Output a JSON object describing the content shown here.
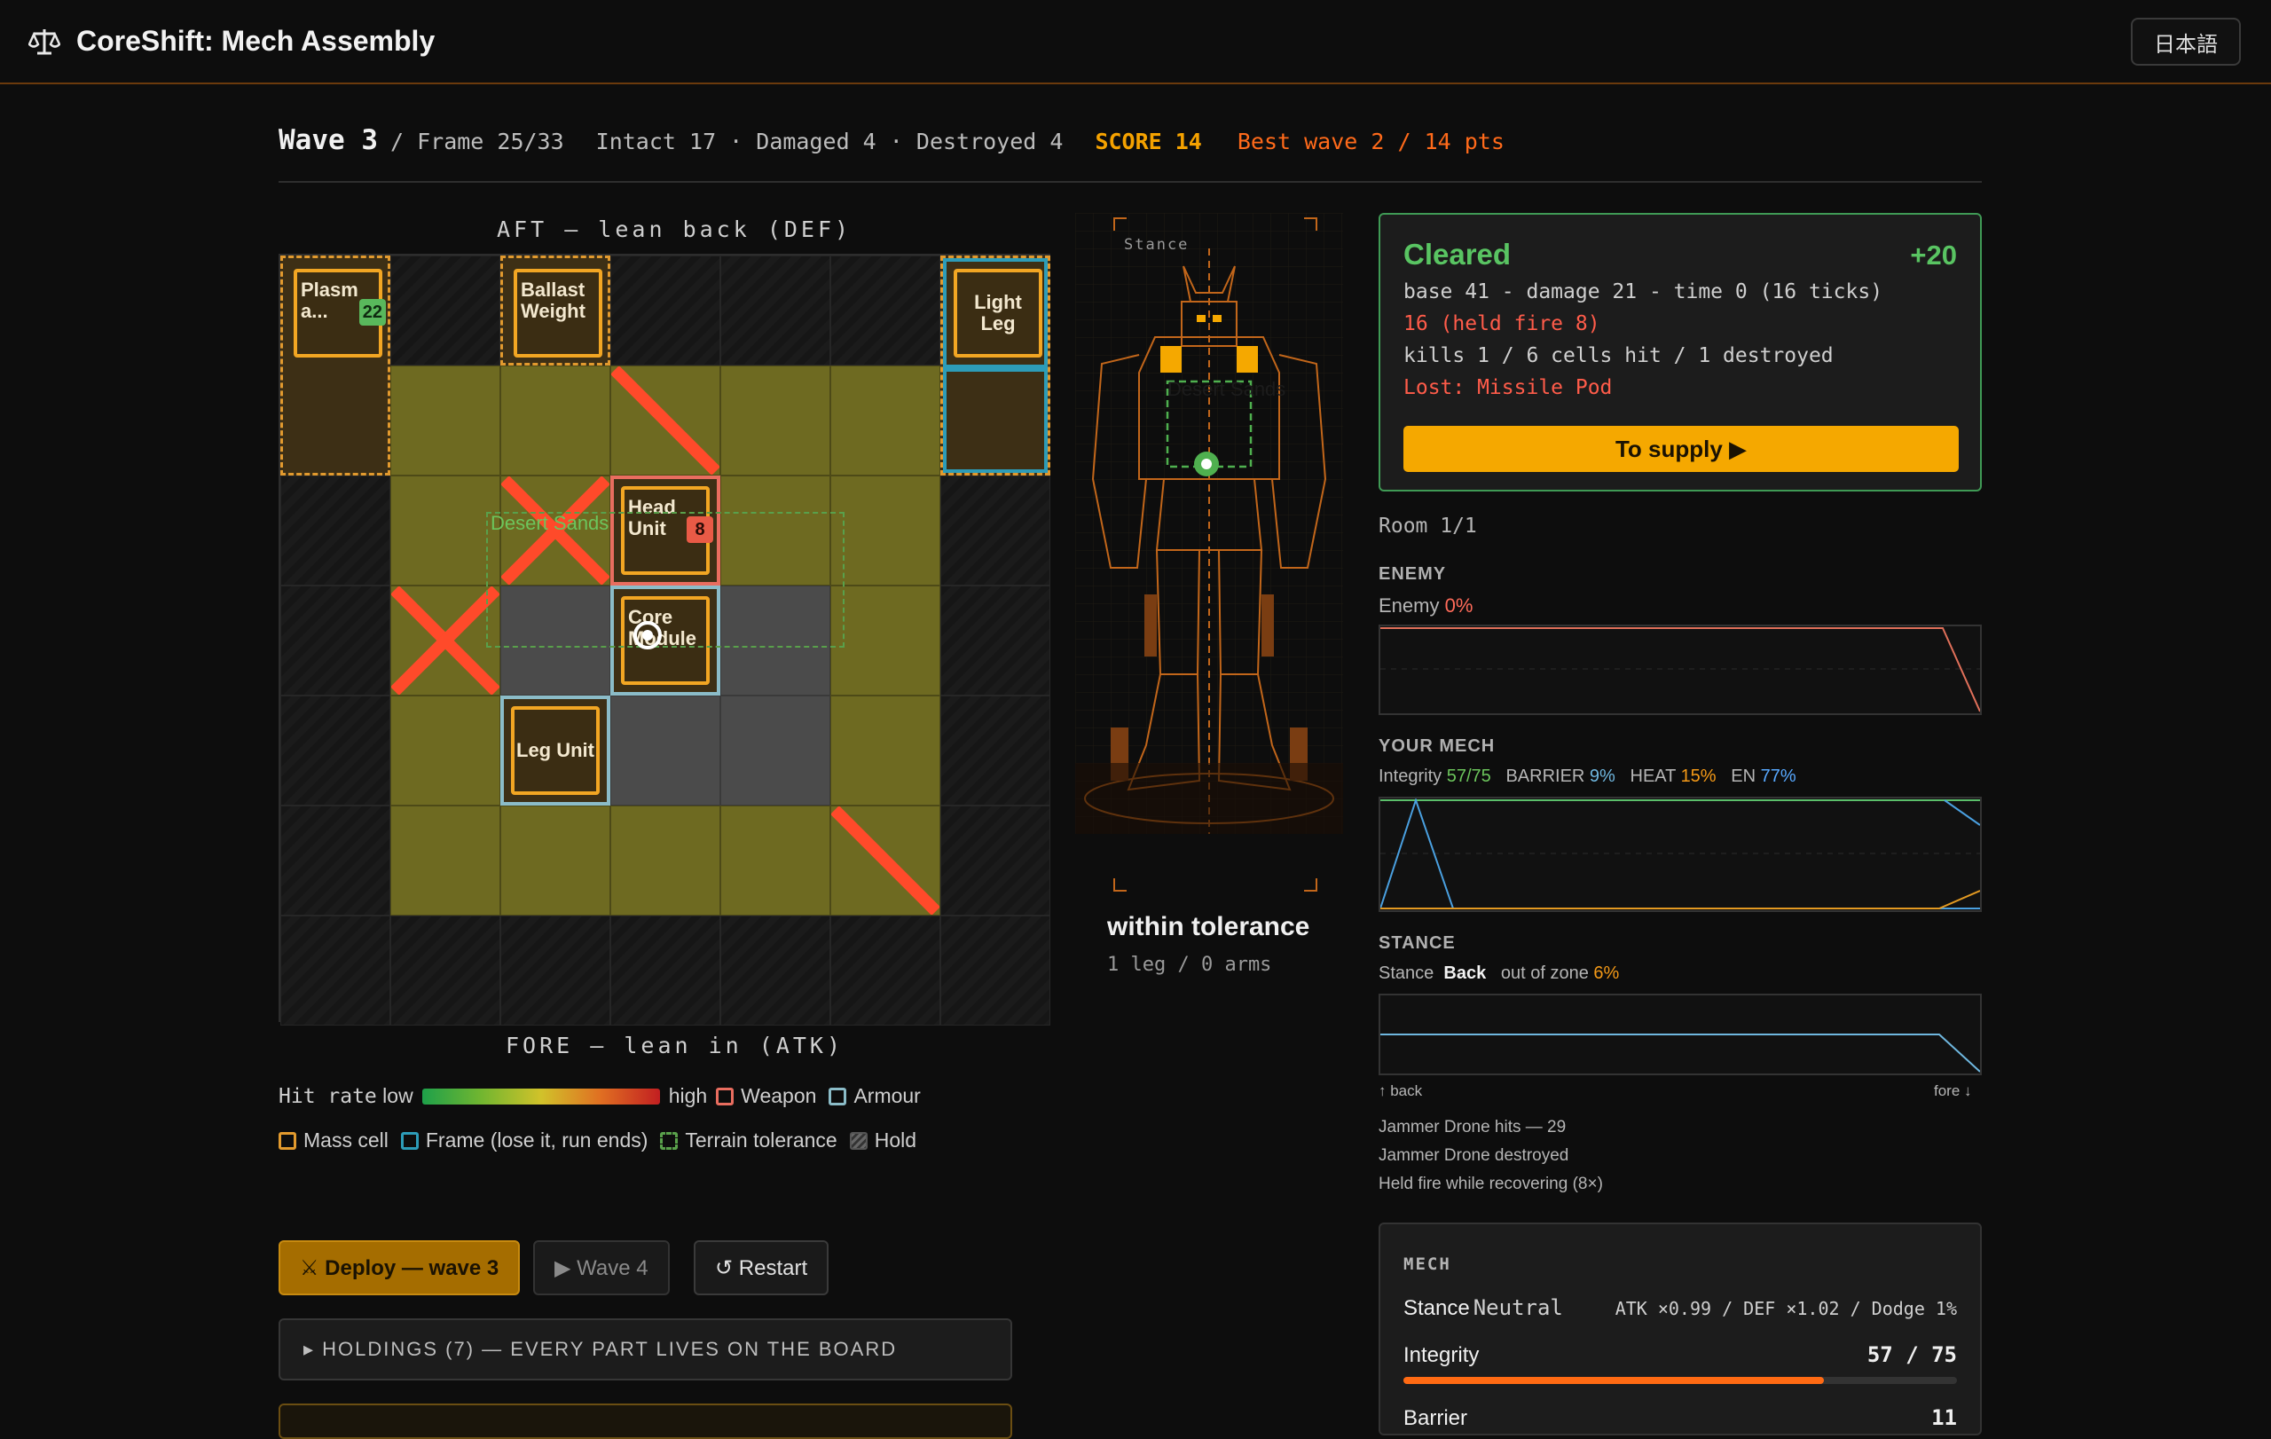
{
  "app": {
    "title": "CoreShift: Mech Assembly",
    "lang_button": "日本語",
    "logo_icon": "scales-icon"
  },
  "status": {
    "wave": "Wave 3",
    "frame": "/ Frame 25/33",
    "counts": "Intact 17 · Damaged 4 · Destroyed 4",
    "score": "SCORE 14",
    "best": "Best wave 2 / 14 pts"
  },
  "board": {
    "aft_label": "AFT — lean back (DEF)",
    "fore_label": "FORE — lean in (ATK)",
    "terrain_label": "Desert Sands",
    "parts": {
      "plasma": {
        "name": "Plasm a...",
        "badge": "22"
      },
      "ballast": {
        "name": "Ballast Weight"
      },
      "light_leg": {
        "name": "Light Leg"
      },
      "head": {
        "name": "Head Unit",
        "badge": "8"
      },
      "core": {
        "name": "Core Module"
      },
      "leg": {
        "name": "Leg Unit"
      }
    }
  },
  "legend": {
    "hit_rate": "Hit rate",
    "low": "low",
    "high": "high",
    "weapon": "Weapon",
    "armour": "Armour",
    "mass": "Mass cell",
    "frame": "Frame (lose it, run ends)",
    "terrain": "Terrain tolerance",
    "hold": "Hold",
    "colors": {
      "weapon": "#e96d5f",
      "armour": "#8bbcc8",
      "mass": "#e29a2e",
      "frame": "#2d9cb8",
      "terrain": "#59a04b"
    }
  },
  "actions": {
    "deploy": "⚔ Deploy — wave 3",
    "wave4": "▶ Wave 4",
    "restart": "↺ Restart",
    "holdings": "▸ HOLDINGS (7) — EVERY PART LIVES ON THE BOARD"
  },
  "mech_view": {
    "stance_label": "Stance",
    "terrain_label": "Desert Sands",
    "caption": "within tolerance",
    "sub": "1 leg / 0 arms"
  },
  "result": {
    "title": "Cleared",
    "plus": "+20",
    "line1": "base 41 - damage 21 - time 0 (16 ticks)",
    "line2": "16 (held fire 8)",
    "line3": "kills 1 / 6 cells hit / 1 destroyed",
    "line4": "Lost: Missile Pod",
    "supply_button": "To supply ▶"
  },
  "room": "Room 1/1",
  "enemy": {
    "heading": "ENEMY",
    "label": "Enemy",
    "value": "0%"
  },
  "your_mech": {
    "heading": "YOUR MECH",
    "integrity_label": "Integrity",
    "integrity": "57/75",
    "barrier_label": "BARRIER",
    "barrier": "9%",
    "heat_label": "HEAT",
    "heat": "15%",
    "en_label": "EN",
    "en": "77%"
  },
  "stance": {
    "heading": "STANCE",
    "label": "Stance",
    "value": "Back",
    "zone_label": "out of zone",
    "zone_value": "6%",
    "back": "↑ back",
    "fore": "fore ↓"
  },
  "log": [
    "Jammer Drone hits — 29",
    "Jammer Drone destroyed",
    "Held fire while recovering (8×)"
  ],
  "mech_card": {
    "title": "MECH",
    "stance_label": "Stance",
    "stance_value": "Neutral",
    "stance_stats": "ATK ×0.99 / DEF ×1.02 / Dodge 1%",
    "integrity_label": "Integrity",
    "integrity_value": "57 / 75",
    "integrity_fraction": 0.76,
    "barrier_label": "Barrier",
    "barrier_value": "11"
  }
}
